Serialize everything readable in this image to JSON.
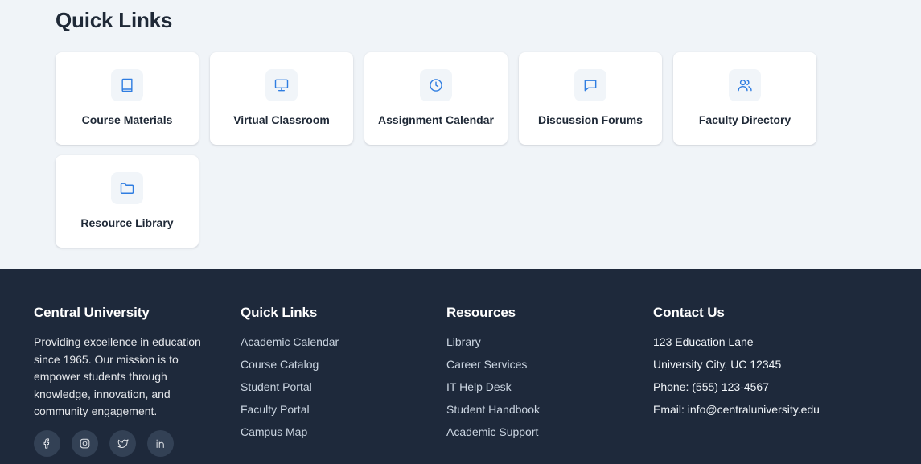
{
  "quick_links": {
    "title": "Quick Links",
    "cards": [
      {
        "label": "Course Materials",
        "icon": "book-icon"
      },
      {
        "label": "Virtual Classroom",
        "icon": "monitor-icon"
      },
      {
        "label": "Assignment Calendar",
        "icon": "clock-icon"
      },
      {
        "label": "Discussion Forums",
        "icon": "message-icon"
      },
      {
        "label": "Faculty Directory",
        "icon": "users-icon"
      },
      {
        "label": "Resource Library",
        "icon": "folder-icon"
      }
    ]
  },
  "footer": {
    "about": {
      "title": "Central University",
      "text": "Providing excellence in education since 1965. Our mission is to empower students through knowledge, innovation, and community engagement.",
      "social": [
        "facebook-icon",
        "instagram-icon",
        "twitter-icon",
        "linkedin-icon"
      ]
    },
    "quick_links": {
      "title": "Quick Links",
      "items": [
        "Academic Calendar",
        "Course Catalog",
        "Student Portal",
        "Faculty Portal",
        "Campus Map"
      ]
    },
    "resources": {
      "title": "Resources",
      "items": [
        "Library",
        "Career Services",
        "IT Help Desk",
        "Student Handbook",
        "Academic Support"
      ]
    },
    "contact": {
      "title": "Contact Us",
      "address": "123 Education Lane",
      "city": "University City, UC 12345",
      "phone": "Phone: (555) 123-4567",
      "email": "Email: info@centraluniversity.edu"
    }
  },
  "colors": {
    "accent": "#2f7de1",
    "page_bg": "#f0f4f8",
    "footer_bg": "#1e293b"
  }
}
